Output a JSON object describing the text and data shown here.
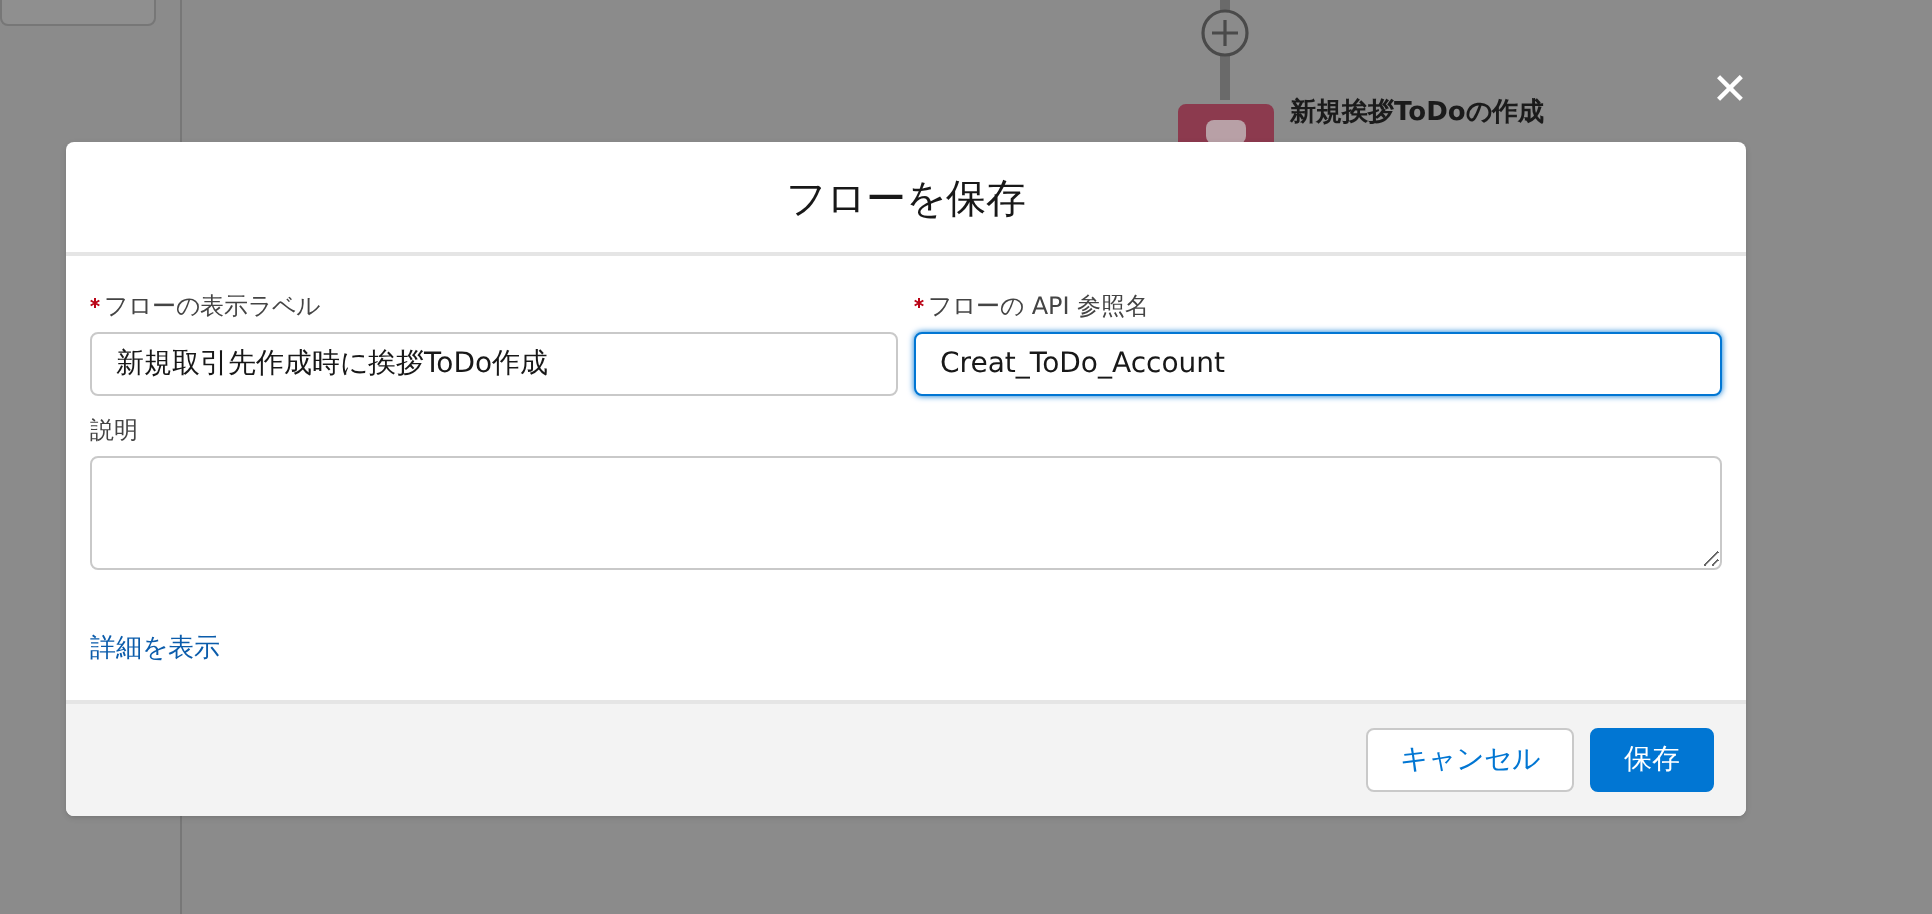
{
  "canvas": {
    "node": {
      "title": "新規挨拶ToDoの作成"
    }
  },
  "close_label": "✕",
  "modal": {
    "title": "フローを保存",
    "fields": [
      {
        "label": "フローの表示ラベル",
        "required": true,
        "value": "新規取引先作成時に挨拶ToDo作成",
        "focused": false
      },
      {
        "label": "フローの API 参照名",
        "required": true,
        "value": "Creat_ToDo_Account",
        "focused": true
      }
    ],
    "description": {
      "label": "説明"
    },
    "details_link": "詳細を表示",
    "buttons": [
      {
        "label": "キャンセル",
        "kind": "neutral"
      },
      {
        "label": "保存",
        "kind": "brand"
      }
    ]
  }
}
